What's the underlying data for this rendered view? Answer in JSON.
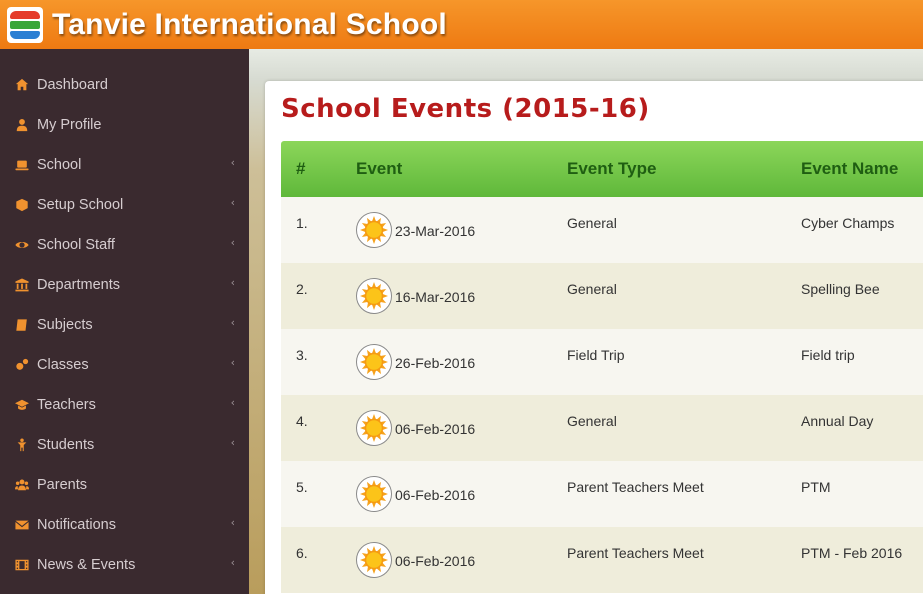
{
  "header": {
    "title": "Tanvie International School"
  },
  "sidebar": {
    "items": [
      {
        "label": "Dashboard",
        "icon": "home-icon",
        "chevron": false
      },
      {
        "label": "My Profile",
        "icon": "user-icon",
        "chevron": false
      },
      {
        "label": "School",
        "icon": "laptop-icon",
        "chevron": true
      },
      {
        "label": "Setup School",
        "icon": "cube-icon",
        "chevron": true
      },
      {
        "label": "School Staff",
        "icon": "eye-icon",
        "chevron": true
      },
      {
        "label": "Departments",
        "icon": "bank-icon",
        "chevron": true
      },
      {
        "label": "Subjects",
        "icon": "book-icon",
        "chevron": true
      },
      {
        "label": "Classes",
        "icon": "cogs-icon",
        "chevron": true
      },
      {
        "label": "Teachers",
        "icon": "graduation-cap-icon",
        "chevron": true
      },
      {
        "label": "Students",
        "icon": "child-icon",
        "chevron": true
      },
      {
        "label": "Parents",
        "icon": "users-icon",
        "chevron": false
      },
      {
        "label": "Notifications",
        "icon": "envelope-icon",
        "chevron": true
      },
      {
        "label": "News & Events",
        "icon": "film-icon",
        "chevron": true
      }
    ],
    "chevron_glyph": "‹"
  },
  "main": {
    "page_title": "School Events (2015-16)",
    "table": {
      "headers": [
        "#",
        "Event",
        "Event Type",
        "Event Name"
      ],
      "rows": [
        {
          "num": "1.",
          "date": "23-Mar-2016",
          "type": "General",
          "name": "Cyber Champs"
        },
        {
          "num": "2.",
          "date": "16-Mar-2016",
          "type": "General",
          "name": "Spelling Bee"
        },
        {
          "num": "3.",
          "date": "26-Feb-2016",
          "type": "Field Trip",
          "name": "Field trip"
        },
        {
          "num": "4.",
          "date": "06-Feb-2016",
          "type": "General",
          "name": "Annual Day"
        },
        {
          "num": "5.",
          "date": "06-Feb-2016",
          "type": "Parent Teachers Meet",
          "name": "PTM"
        },
        {
          "num": "6.",
          "date": "06-Feb-2016",
          "type": "Parent Teachers Meet",
          "name": "PTM - Feb 2016"
        }
      ]
    }
  },
  "colors": {
    "header_orange": "#f08a1e",
    "sidebar_bg": "#3a2a2f",
    "icon_orange": "#f0922f",
    "title_red": "#b71c1c",
    "table_header_green": "#6cc145",
    "header_text_green": "#1f5e12"
  }
}
